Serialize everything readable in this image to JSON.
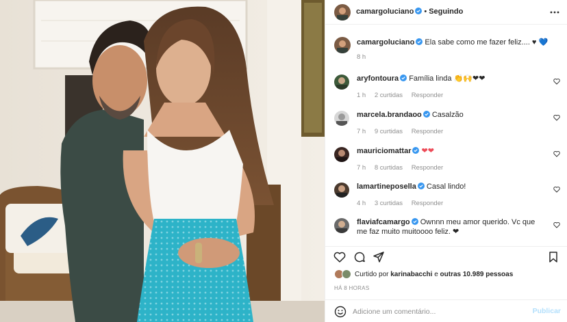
{
  "post": {
    "author": "camargoluciano",
    "separator": "•",
    "follow_status": "Seguindo",
    "photo_alt": "Casal abraçado em uma sala"
  },
  "caption": {
    "username": "camargoluciano",
    "text": "Ela sabe como me fazer feliz.... ♥ 💙",
    "time": "8 h"
  },
  "comments": [
    {
      "username": "aryfontoura",
      "text": "Família linda 👏🙌❤❤",
      "time": "1 h",
      "likes": "2 curtidas",
      "reply": "Responder"
    },
    {
      "username": "marcela.brandaoo",
      "text": "Casalzão",
      "time": "7 h",
      "likes": "9 curtidas",
      "reply": "Responder"
    },
    {
      "username": "mauriciomattar",
      "text": "❤❤",
      "time": "7 h",
      "likes": "8 curtidas",
      "reply": "Responder"
    },
    {
      "username": "lamartineposella",
      "text": "Casal lindo!",
      "time": "4 h",
      "likes": "3 curtidas",
      "reply": "Responder"
    },
    {
      "username": "flaviafcamargo",
      "text": "Ownnn meu amor querido. Vc que me faz muito muitoooo feliz. ❤",
      "time": "",
      "likes": "",
      "reply": ""
    }
  ],
  "likes": {
    "prefix": "Curtido por",
    "user": "karinabacchi",
    "middle": "e",
    "others": "outras 10.989 pessoas"
  },
  "posted_ago": "HÁ 8 HORAS",
  "comment_box": {
    "placeholder": "Adicione um comentário...",
    "post_label": "Publicar"
  },
  "colors": {
    "verified": "#3897f0",
    "heart": "#ed4956",
    "muted": "#8e8e8e",
    "post_disabled": "#b2dffc",
    "skirt": "#2fb3c9"
  },
  "icons": [
    "verified-icon",
    "more-icon",
    "heart-icon",
    "comment-icon",
    "share-icon",
    "bookmark-icon",
    "emoji-icon"
  ]
}
